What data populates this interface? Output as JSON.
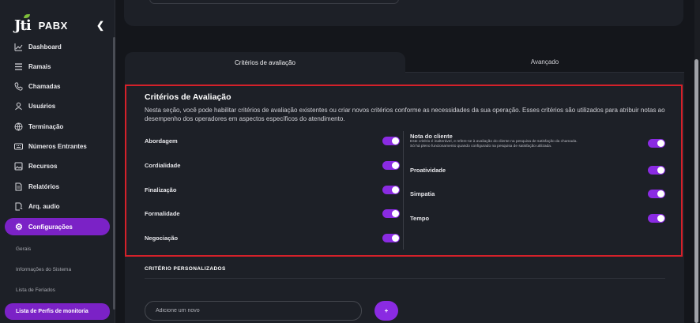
{
  "app": {
    "brand": "Jti",
    "product": "PABX"
  },
  "sidebar": {
    "items": [
      {
        "label": "Dashboard",
        "icon": "chart-icon"
      },
      {
        "label": "Ramais",
        "icon": "list-icon"
      },
      {
        "label": "Chamadas",
        "icon": "phone-icon"
      },
      {
        "label": "Usuários",
        "icon": "user-icon"
      },
      {
        "label": "Terminação",
        "icon": "globe-icon"
      },
      {
        "label": "Números Entrantes",
        "icon": "keypad-icon"
      },
      {
        "label": "Recursos",
        "icon": "gallery-icon"
      },
      {
        "label": "Relatórios",
        "icon": "document-icon"
      },
      {
        "label": "Arq. audio",
        "icon": "audio-file-icon"
      }
    ],
    "active": {
      "label": "Configurações",
      "icon": "gear-icon"
    },
    "sub_items": [
      "Gerais",
      "Informações do Sistema",
      "Lista de Feriados"
    ],
    "sub_active": "Lista de Perfis de monitoria"
  },
  "tabs": {
    "criteria": "Critérios de avaliação",
    "advanced": "Avançado"
  },
  "criteria": {
    "title": "Critérios de Avaliação",
    "description": "Nesta seção, você pode habilitar critérios de avaliação existentes ou criar novos critérios conforme as necessidades da sua operação. Esses critérios são utilizados para atribuir notas ao desempenho dos operadores em aspectos específicos do atendimento.",
    "left": [
      "Abordagem",
      "Cordialidade",
      "Finalização",
      "Formalidade",
      "Negociação"
    ],
    "nota": {
      "title": "Nota do cliente",
      "desc1": "Este critério é inalterável, e refere-se à avaliação do cliente na pesquisa de satisfação da chamada.",
      "desc2": "Só há pleno funcionamento quando configurado na pesquisa de satisfação utilizada."
    },
    "right": [
      "Proatividade",
      "Simpatia",
      "Tempo"
    ]
  },
  "custom": {
    "title": "CRITÉRIO PERSONALIZADOS",
    "placeholder": "Adicione um novo",
    "add_label": "+"
  },
  "colors": {
    "accent": "#8a2be2",
    "active_nav": "#7b22c6",
    "highlight_border": "#d4212a"
  }
}
